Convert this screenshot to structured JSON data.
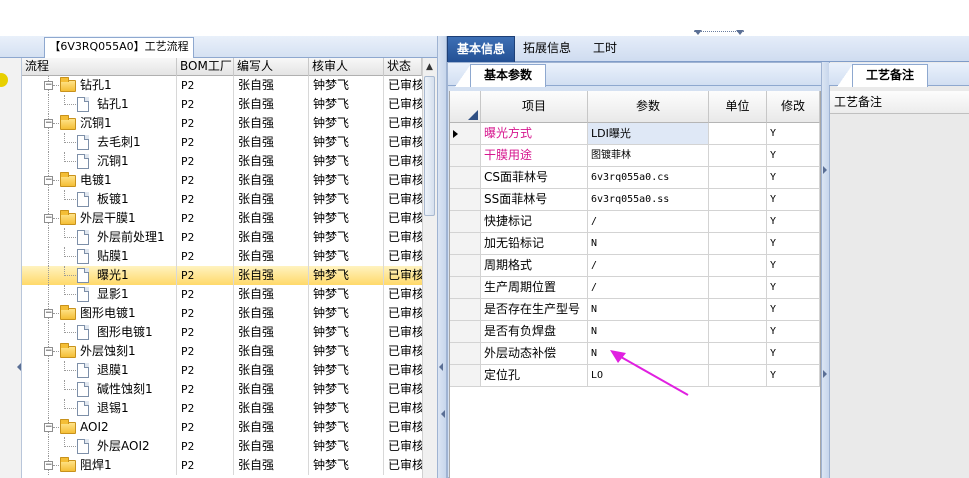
{
  "left_panel": {
    "tab_title": "【6V3RQ055A0】工艺流程",
    "columns": [
      "流程",
      "BOM工厂",
      "编写人",
      "核审人",
      "状态"
    ],
    "rows": [
      {
        "level": 0,
        "type": "folder",
        "name": "钻孔1",
        "bom": "P2",
        "writer": "张自强",
        "reviewer": "钟梦飞",
        "status": "已审核"
      },
      {
        "level": 1,
        "type": "doc",
        "name": "钻孔1",
        "bom": "P2",
        "writer": "张自强",
        "reviewer": "钟梦飞",
        "status": "已审核"
      },
      {
        "level": 0,
        "type": "folder",
        "name": "沉铜1",
        "bom": "P2",
        "writer": "张自强",
        "reviewer": "钟梦飞",
        "status": "已审核"
      },
      {
        "level": 1,
        "type": "doc",
        "name": "去毛刺1",
        "bom": "P2",
        "writer": "张自强",
        "reviewer": "钟梦飞",
        "status": "已审核"
      },
      {
        "level": 1,
        "type": "doc",
        "name": "沉铜1",
        "bom": "P2",
        "writer": "张自强",
        "reviewer": "钟梦飞",
        "status": "已审核"
      },
      {
        "level": 0,
        "type": "folder",
        "name": "电镀1",
        "bom": "P2",
        "writer": "张自强",
        "reviewer": "钟梦飞",
        "status": "已审核"
      },
      {
        "level": 1,
        "type": "doc",
        "name": "板镀1",
        "bom": "P2",
        "writer": "张自强",
        "reviewer": "钟梦飞",
        "status": "已审核"
      },
      {
        "level": 0,
        "type": "folder",
        "name": "外层干膜1",
        "bom": "P2",
        "writer": "张自强",
        "reviewer": "钟梦飞",
        "status": "已审核"
      },
      {
        "level": 1,
        "type": "doc",
        "name": "外层前处理1",
        "bom": "P2",
        "writer": "张自强",
        "reviewer": "钟梦飞",
        "status": "已审核"
      },
      {
        "level": 1,
        "type": "doc",
        "name": "贴膜1",
        "bom": "P2",
        "writer": "张自强",
        "reviewer": "钟梦飞",
        "status": "已审核"
      },
      {
        "level": 1,
        "type": "doc",
        "name": "曝光1",
        "bom": "P2",
        "writer": "张自强",
        "reviewer": "钟梦飞",
        "status": "已审核",
        "selected": true
      },
      {
        "level": 1,
        "type": "doc",
        "name": "显影1",
        "bom": "P2",
        "writer": "张自强",
        "reviewer": "钟梦飞",
        "status": "已审核"
      },
      {
        "level": 0,
        "type": "folder",
        "name": "图形电镀1",
        "bom": "P2",
        "writer": "张自强",
        "reviewer": "钟梦飞",
        "status": "已审核"
      },
      {
        "level": 1,
        "type": "doc",
        "name": "图形电镀1",
        "bom": "P2",
        "writer": "张自强",
        "reviewer": "钟梦飞",
        "status": "已审核"
      },
      {
        "level": 0,
        "type": "folder",
        "name": "外层蚀刻1",
        "bom": "P2",
        "writer": "张自强",
        "reviewer": "钟梦飞",
        "status": "已审核"
      },
      {
        "level": 1,
        "type": "doc",
        "name": "退膜1",
        "bom": "P2",
        "writer": "张自强",
        "reviewer": "钟梦飞",
        "status": "已审核"
      },
      {
        "level": 1,
        "type": "doc",
        "name": "碱性蚀刻1",
        "bom": "P2",
        "writer": "张自强",
        "reviewer": "钟梦飞",
        "status": "已审核"
      },
      {
        "level": 1,
        "type": "doc",
        "name": "退锡1",
        "bom": "P2",
        "writer": "张自强",
        "reviewer": "钟梦飞",
        "status": "已审核"
      },
      {
        "level": 0,
        "type": "folder",
        "name": "AOI2",
        "bom": "P2",
        "writer": "张自强",
        "reviewer": "钟梦飞",
        "status": "已审核"
      },
      {
        "level": 1,
        "type": "doc",
        "name": "外层AOI2",
        "bom": "P2",
        "writer": "张自强",
        "reviewer": "钟梦飞",
        "status": "已审核"
      },
      {
        "level": 0,
        "type": "folder",
        "name": "阻焊1",
        "bom": "P2",
        "writer": "张自强",
        "reviewer": "钟梦飞",
        "status": "已审核"
      }
    ]
  },
  "right_tabs": [
    "基本信息",
    "拓展信息",
    "工时"
  ],
  "params": {
    "subtab": "基本参数",
    "columns": [
      "项目",
      "参数",
      "单位",
      "修改"
    ],
    "rows": [
      {
        "item": "曝光方式",
        "param": "LDI曝光",
        "unit": "",
        "mod": "Y",
        "current": true,
        "pink": true
      },
      {
        "item": "干膜用途",
        "param": "图镀菲林",
        "unit": "",
        "mod": "Y",
        "pink": true
      },
      {
        "item": "CS面菲林号",
        "param": "6v3rq055a0.cs",
        "unit": "",
        "mod": "Y"
      },
      {
        "item": "SS面菲林号",
        "param": "6v3rq055a0.ss",
        "unit": "",
        "mod": "Y"
      },
      {
        "item": "快捷标记",
        "param": "/",
        "unit": "",
        "mod": "Y"
      },
      {
        "item": "加无铅标记",
        "param": "N",
        "unit": "",
        "mod": "Y"
      },
      {
        "item": "周期格式",
        "param": "/",
        "unit": "",
        "mod": "Y"
      },
      {
        "item": "生产周期位置",
        "param": "/",
        "unit": "",
        "mod": "Y"
      },
      {
        "item": "是否存在生产型号",
        "param": "N",
        "unit": "",
        "mod": "Y"
      },
      {
        "item": "是否有负焊盘",
        "param": "N",
        "unit": "",
        "mod": "Y"
      },
      {
        "item": "外层动态补偿",
        "param": "N",
        "unit": "",
        "mod": "Y"
      },
      {
        "item": "定位孔",
        "param": "LO",
        "unit": "",
        "mod": "Y"
      }
    ]
  },
  "notes": {
    "tab": "工艺备注",
    "header": "工艺备注"
  },
  "colors": {
    "accent_blue": "#234f93",
    "selection": "#ffd96a",
    "pink_text": "#d6158e",
    "annotation_arrow": "#e020e0"
  }
}
